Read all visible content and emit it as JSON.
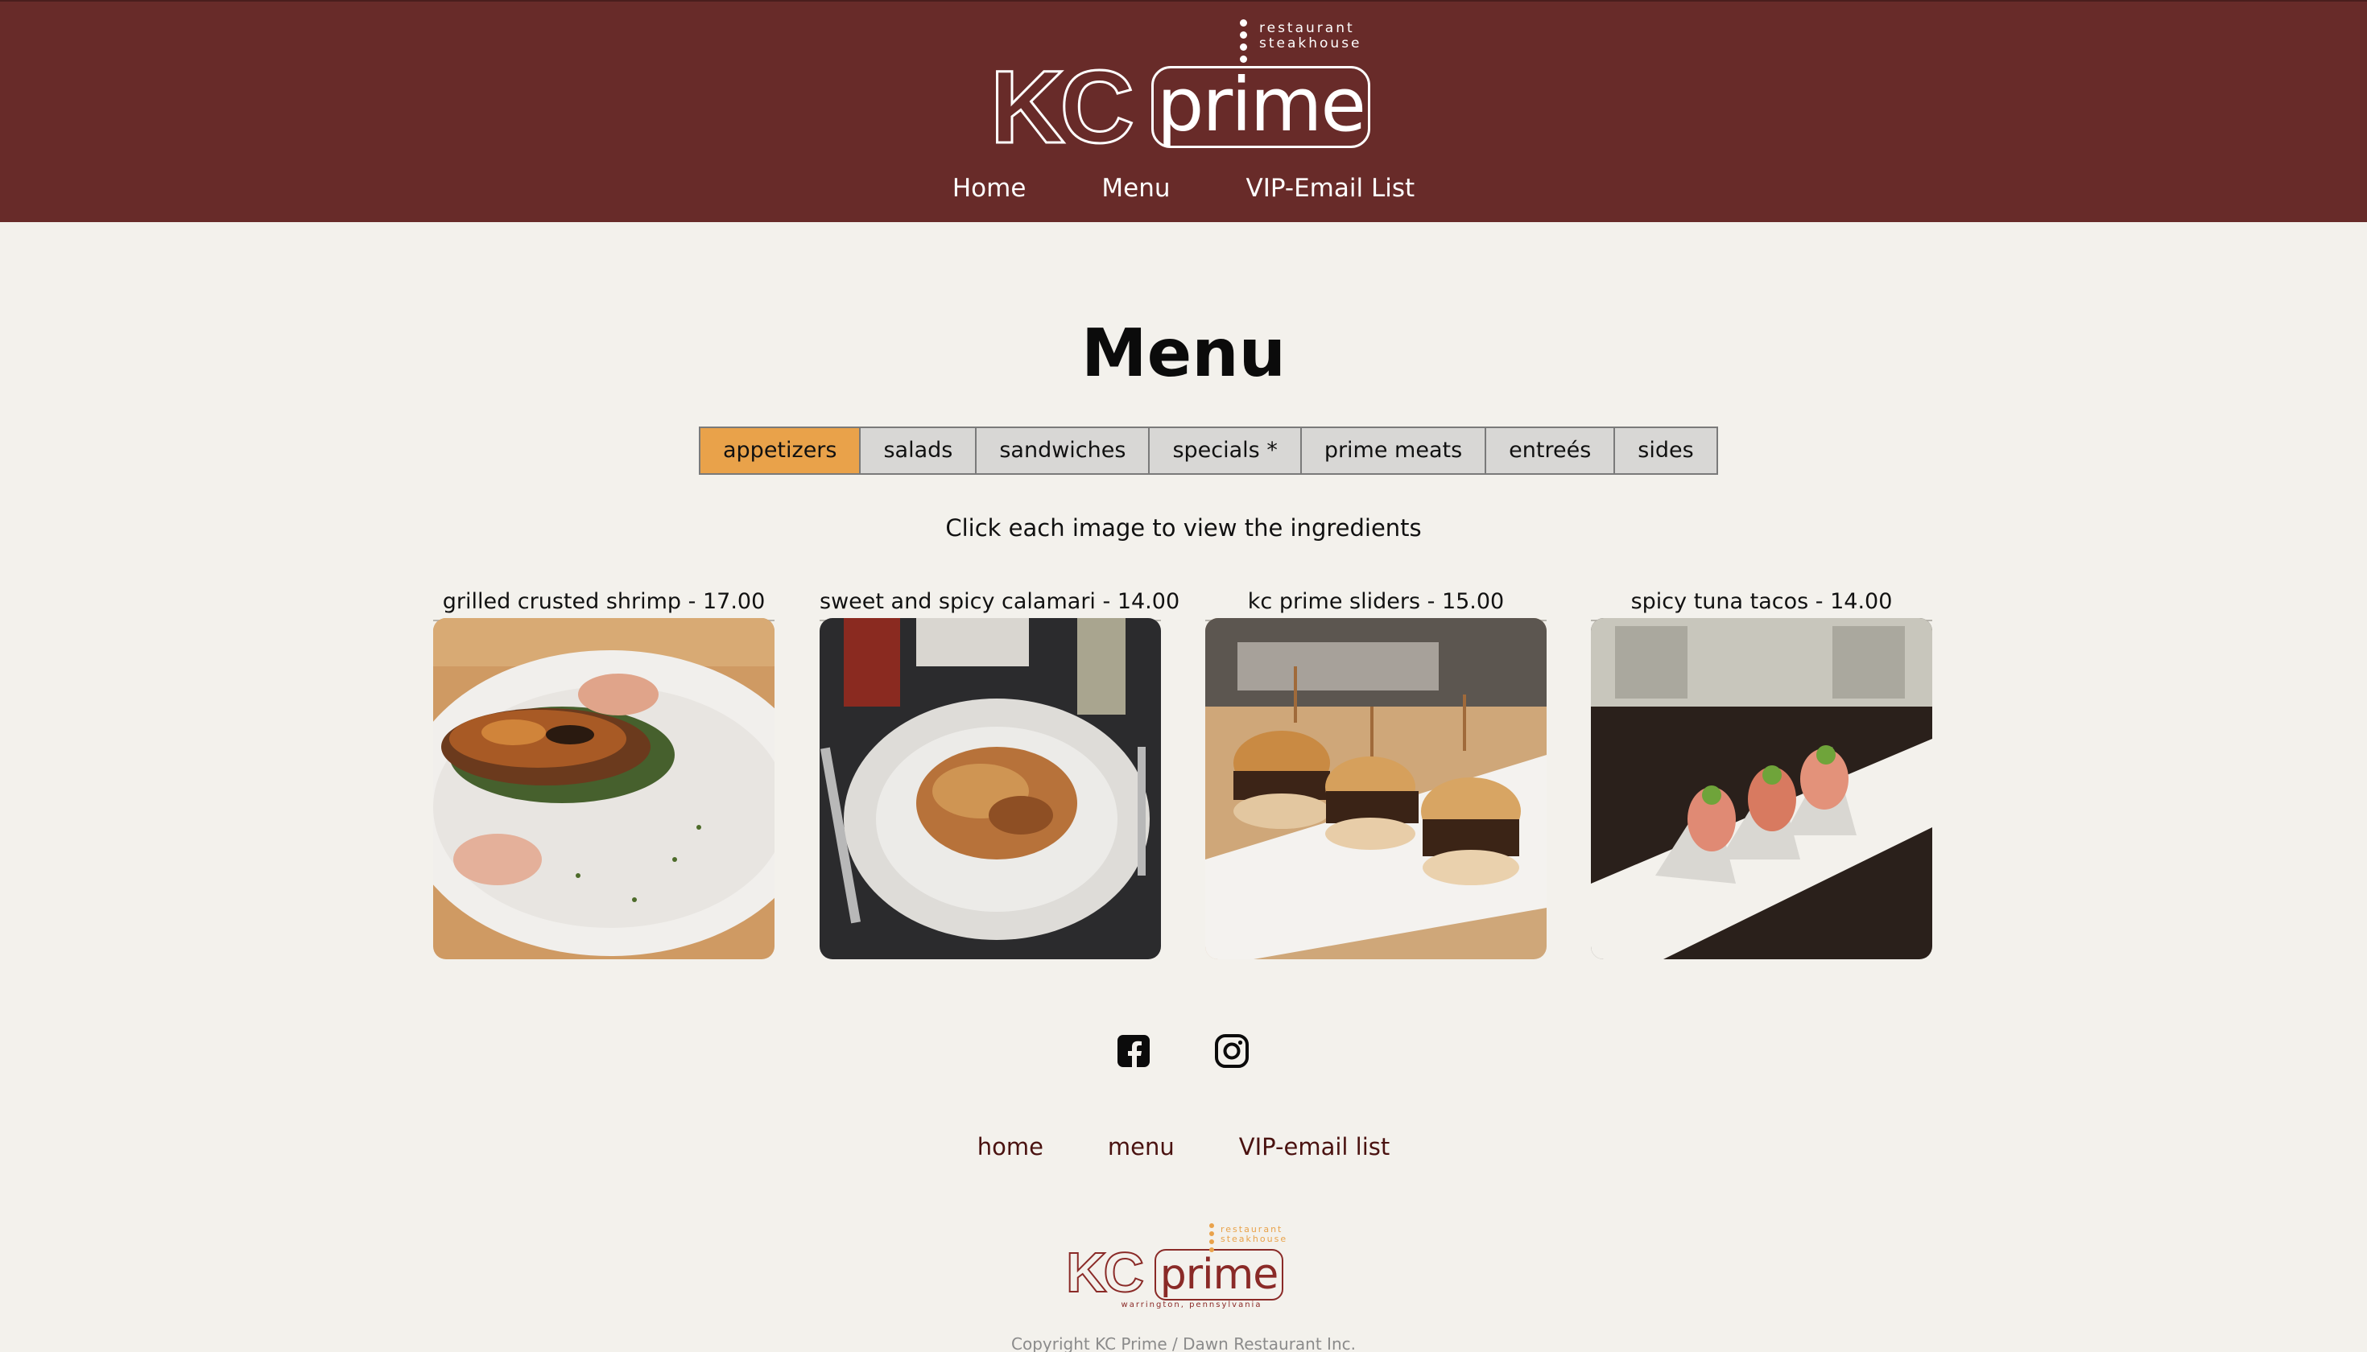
{
  "header": {
    "logo": {
      "kc": "KC",
      "prime": "prime",
      "tagline_line1": "restaurant",
      "tagline_line2": "steakhouse"
    },
    "nav": [
      {
        "label": "Home"
      },
      {
        "label": "Menu"
      },
      {
        "label": "VIP-Email List"
      }
    ]
  },
  "main": {
    "title": "Menu",
    "tabs": [
      {
        "label": "appetizers",
        "active": true
      },
      {
        "label": "salads"
      },
      {
        "label": "sandwiches"
      },
      {
        "label": "specials *"
      },
      {
        "label": "prime meats"
      },
      {
        "label": "entreés"
      },
      {
        "label": "sides"
      }
    ],
    "hint": "Click each image to view the ingredients",
    "items": [
      {
        "caption": "grilled crusted shrimp - 17.00",
        "image": "grilled-shrimp-photo"
      },
      {
        "caption": "sweet and spicy calamari - 14.00",
        "image": "calamari-photo"
      },
      {
        "caption": "kc prime sliders - 15.00",
        "image": "sliders-photo"
      },
      {
        "caption": "spicy tuna tacos - 14.00",
        "image": "tuna-tacos-photo"
      }
    ]
  },
  "footer": {
    "social": [
      {
        "icon": "facebook-icon"
      },
      {
        "icon": "instagram-icon"
      }
    ],
    "nav": [
      {
        "label": "home"
      },
      {
        "label": "menu"
      },
      {
        "label": "VIP-email list"
      }
    ],
    "logo": {
      "kc": "KC",
      "prime": "prime",
      "tagline_line1": "restaurant",
      "tagline_line2": "steakhouse",
      "location": "warrington, pennsylvania"
    },
    "copyright": "Copyright KC Prime / Dawn Restaurant Inc."
  },
  "colors": {
    "header_bg": "#682b29",
    "page_bg": "#f3f1ec",
    "active_tab": "#e9a24a",
    "tab_bg": "#d8d7d5",
    "footer_link": "#4a1210",
    "logo_accent": "#8a2a27"
  }
}
